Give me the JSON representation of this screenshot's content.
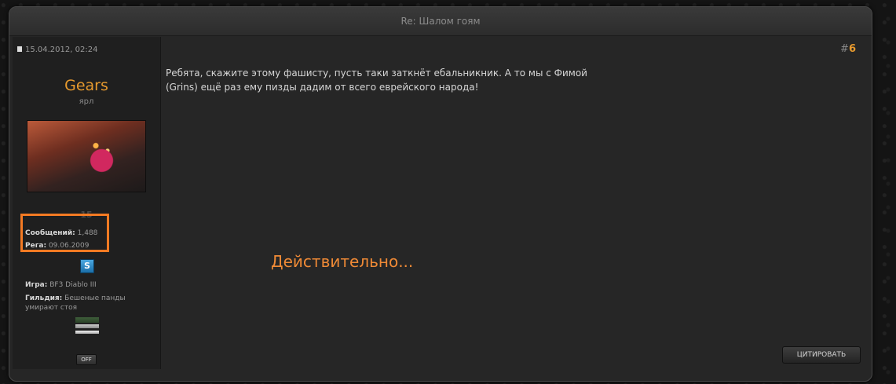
{
  "window": {
    "title": "Re: Шалом гоям"
  },
  "post": {
    "date": "15.04.2012, 02:24",
    "number_prefix": "#",
    "number": "6",
    "message": "Ребята, скажите этому фашисту, пусть таки заткнёт ебальникник. А то мы с Фимой (Grins) ещё раз ему пизды дадим от всего еврейского народа!",
    "quote_button": "ЦИТИРОВАТЬ"
  },
  "user": {
    "name": "Gears",
    "title": "ярл",
    "rep": "15",
    "posts_label": "Сообщений:",
    "posts_value": "1,488",
    "reg_label": "Рега:",
    "reg_value": "09.06.2009",
    "game_label": "Игра:",
    "game_value": "BF3 Diablo III",
    "guild_label": "Гильдия:",
    "guild_value": "Бешеные панды умирают стоя",
    "status_button": "OFF",
    "skype_letter": "S"
  },
  "annotation": {
    "text": "Действительно...",
    "color": "#f47a23"
  },
  "colors": {
    "accent": "#e79a2e",
    "highlight": "#f47a23"
  }
}
